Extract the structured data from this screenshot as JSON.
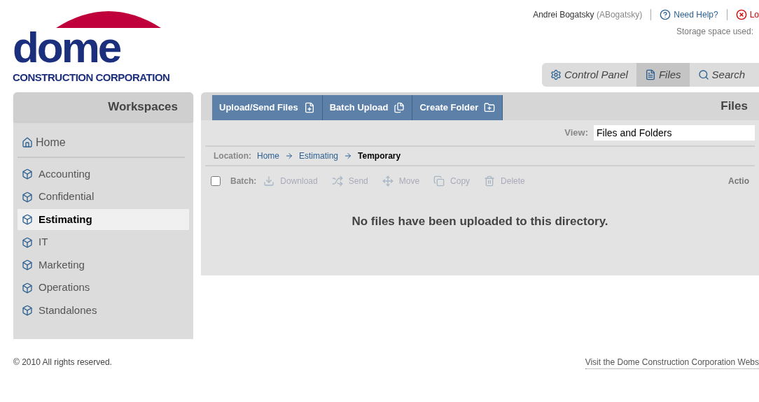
{
  "logo": {
    "wordmark": "dome",
    "subtitle": "CONSTRUCTION CORPORATION"
  },
  "user_bar": {
    "user_name": "Andrei Bogatsky",
    "user_login": "(ABogatsky)",
    "help_link": "Need Help?",
    "logout_link": "Lo",
    "storage": "Storage space used:"
  },
  "main_tabs": [
    {
      "label": "Control Panel",
      "selected": false
    },
    {
      "label": "Files",
      "selected": true
    },
    {
      "label": "Search",
      "selected": false
    }
  ],
  "sidebar": {
    "title": "Workspaces",
    "home": "Home",
    "items": [
      {
        "label": "Accounting",
        "selected": false
      },
      {
        "label": "Confidential",
        "selected": false
      },
      {
        "label": "Estimating",
        "selected": true
      },
      {
        "label": "IT",
        "selected": false
      },
      {
        "label": "Marketing",
        "selected": false
      },
      {
        "label": "Operations",
        "selected": false
      },
      {
        "label": "Standalones",
        "selected": false
      }
    ]
  },
  "toolbar": {
    "buttons": [
      {
        "label": "Upload/Send Files"
      },
      {
        "label": "Batch Upload"
      },
      {
        "label": "Create Folder"
      }
    ],
    "title": "Files"
  },
  "view": {
    "label": "View:",
    "value": "Files and Folders"
  },
  "location": {
    "label": "Location:",
    "crumbs": [
      {
        "label": "Home",
        "current": false
      },
      {
        "label": "Estimating",
        "current": false
      },
      {
        "label": "Temporary",
        "current": true
      }
    ]
  },
  "batch": {
    "checked": false,
    "label": "Batch:",
    "actions": [
      {
        "label": "Download"
      },
      {
        "label": "Send"
      },
      {
        "label": "Move"
      },
      {
        "label": "Copy"
      },
      {
        "label": "Delete"
      }
    ],
    "actions_header": "Actio"
  },
  "empty_message": "No files have been uploaded to this directory.",
  "footer": {
    "copyright": "© 2010 All rights reserved.",
    "link": "Visit the Dome Construction Corporation Webs"
  }
}
